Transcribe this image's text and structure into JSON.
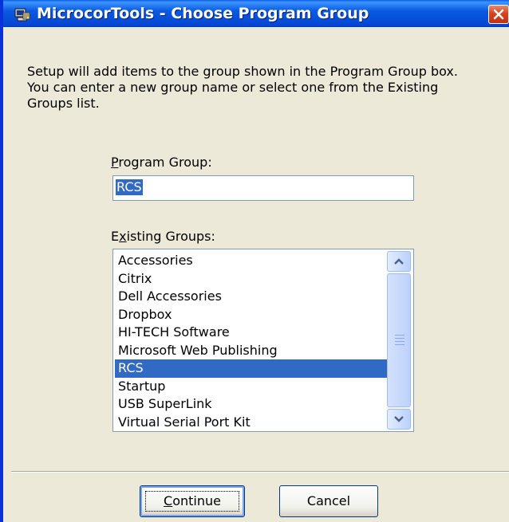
{
  "window": {
    "title": "MicrocorTools - Choose Program Group"
  },
  "description": {
    "line1": "Setup will add items to the group shown in the Program Group box.",
    "line2": "You can enter a new group name or select one from the Existing",
    "line3": "Groups list."
  },
  "program_group": {
    "label_mnemonic": "P",
    "label_rest": "rogram Group:",
    "value": "RCS"
  },
  "existing_groups": {
    "label_before": "E",
    "label_mnemonic": "x",
    "label_rest": "isting Groups:",
    "items": [
      "Accessories",
      "Citrix",
      "Dell Accessories",
      "Dropbox",
      "HI-TECH Software",
      "Microsoft Web Publishing",
      "RCS",
      "Startup",
      "USB SuperLink",
      "Virtual Serial Port Kit"
    ],
    "selected": "RCS"
  },
  "buttons": {
    "continue_mnemonic": "C",
    "continue_rest": "ontinue",
    "cancel": "Cancel"
  },
  "icons": {
    "app": "installer-computer-icon",
    "close": "close-icon",
    "scroll_up": "chevron-up-icon",
    "scroll_down": "chevron-down-icon"
  },
  "colors": {
    "titlebar": "#0a5ae0",
    "selection": "#316ac5",
    "close": "#d9411e"
  }
}
